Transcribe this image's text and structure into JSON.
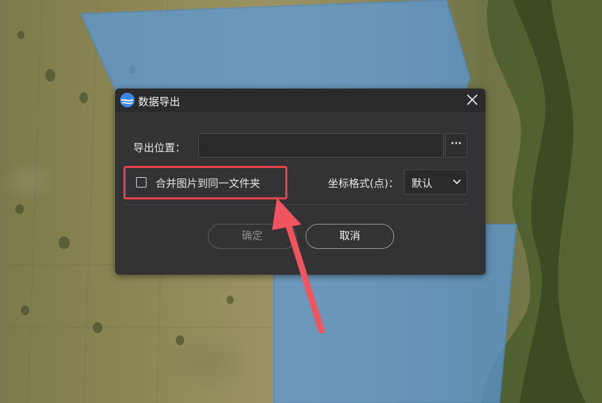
{
  "dialog": {
    "title": "数据导出",
    "export_location_label": "导出位置：",
    "export_location_value": "",
    "browse_label": "···",
    "merge_images_label": "合并图片到同一文件夹",
    "merge_images_checked": false,
    "coord_format_label": "坐标格式(点)：",
    "coord_format_value": "默认",
    "ok_label": "确定",
    "cancel_label": "取消"
  },
  "icons": {
    "logo": "app-logo-icon",
    "close": "close-icon",
    "chevron": "chevron-down-icon"
  },
  "colors": {
    "dialog_bg": "#333335",
    "titlebar_bg": "#2b2b2d",
    "highlight": "#e8434a",
    "logo_blue": "#3a86e0",
    "overlay_blue": "#5a9be0"
  }
}
